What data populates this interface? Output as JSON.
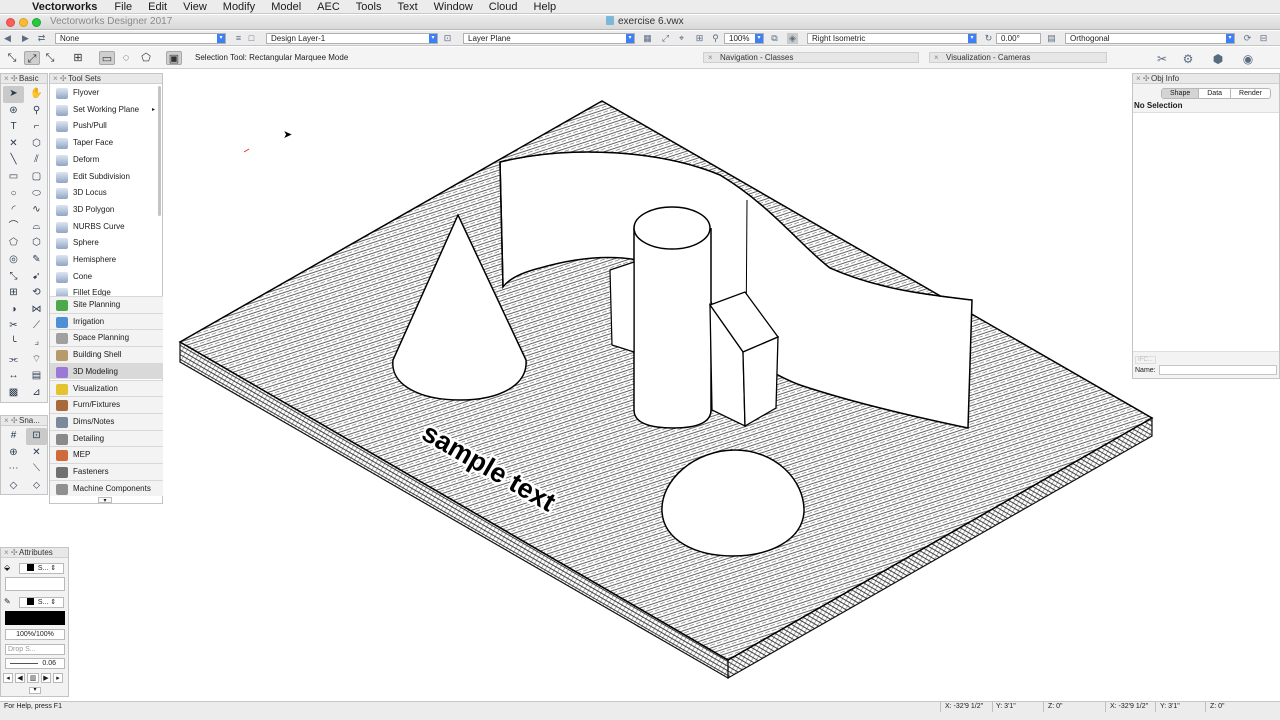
{
  "menubar": {
    "app_name": "Vectorworks",
    "items": [
      "File",
      "Edit",
      "View",
      "Modify",
      "Model",
      "AEC",
      "Tools",
      "Text",
      "Window",
      "Cloud",
      "Help"
    ]
  },
  "window": {
    "app_title": "Vectorworks Designer 2017",
    "doc_title": "exercise 6.vwx"
  },
  "viewbar": {
    "class_value": "None",
    "layer_value": "Design Layer-1",
    "plane_value": "Layer Plane",
    "zoom_value": "100%",
    "view_value": "Right Isometric",
    "angle_value": "0.00°",
    "projection_value": "Orthogonal"
  },
  "modebar": {
    "mode_text": "Selection Tool: Rectangular Marquee Mode"
  },
  "tabs": {
    "navigation": "Navigation - Classes",
    "visualization": "Visualization - Cameras"
  },
  "palettes": {
    "basic_title": "Basic",
    "toolsets_title": "Tool Sets",
    "snap_title": "Sna...",
    "attributes_title": "Attributes",
    "objinfo_title": "Obj Info"
  },
  "toolset_tools": [
    {
      "label": "Flyover",
      "icon": "flyover-icon"
    },
    {
      "label": "Set Working Plane",
      "icon": "working-plane-icon",
      "submenu": "▸"
    },
    {
      "label": "Push/Pull",
      "icon": "push-pull-icon"
    },
    {
      "label": "Taper Face",
      "icon": "taper-face-icon"
    },
    {
      "label": "Deform",
      "icon": "deform-icon"
    },
    {
      "label": "Edit Subdivision",
      "icon": "subdivision-icon"
    },
    {
      "label": "3D Locus",
      "icon": "locus-icon"
    },
    {
      "label": "3D Polygon",
      "icon": "polygon-icon"
    },
    {
      "label": "NURBS Curve",
      "icon": "nurbs-curve-icon"
    },
    {
      "label": "Sphere",
      "icon": "sphere-icon"
    },
    {
      "label": "Hemisphere",
      "icon": "hemisphere-icon"
    },
    {
      "label": "Cone",
      "icon": "cone-icon"
    },
    {
      "label": "Fillet Edge",
      "icon": "fillet-edge-icon"
    }
  ],
  "tool_sets": [
    {
      "label": "Site Planning",
      "icon": "site-planning-icon",
      "color": "#4caa4c"
    },
    {
      "label": "Irrigation",
      "icon": "irrigation-icon",
      "color": "#4f8fd6"
    },
    {
      "label": "Space Planning",
      "icon": "space-planning-icon",
      "color": "#a0a0a0"
    },
    {
      "label": "Building Shell",
      "icon": "building-shell-icon",
      "color": "#b89a6a"
    },
    {
      "label": "3D Modeling",
      "icon": "3d-modeling-icon",
      "color": "#9a7ad6",
      "selected": true
    },
    {
      "label": "Visualization",
      "icon": "visualization-icon",
      "color": "#e4c230"
    },
    {
      "label": "Furn/Fixtures",
      "icon": "furniture-icon",
      "color": "#a86a3a"
    },
    {
      "label": "Dims/Notes",
      "icon": "dims-notes-icon",
      "color": "#7a8a9a"
    },
    {
      "label": "Detailing",
      "icon": "detailing-icon",
      "color": "#8a8a8a"
    },
    {
      "label": "MEP",
      "icon": "mep-icon",
      "color": "#d06a3a"
    },
    {
      "label": "Fasteners",
      "icon": "fasteners-icon",
      "color": "#707070"
    },
    {
      "label": "Machine Components",
      "icon": "machine-components-icon",
      "color": "#909090"
    }
  ],
  "attributes": {
    "fill_style": "S...",
    "pen_style": "S...",
    "opacity": "100%/100%",
    "drop_shadow": "Drop S...",
    "line_weight": "0.06"
  },
  "objinfo": {
    "tabs": [
      "Shape",
      "Data",
      "Render"
    ],
    "selected_tab": "Shape",
    "no_selection": "No Selection",
    "ifc_label": "IFC...",
    "name_label": "Name:"
  },
  "canvas": {
    "text_object": "sample text"
  },
  "statusbar": {
    "help_text": "For Help, press F1",
    "x_abs": "X: -32'9 1/2\"",
    "y_abs": "Y: 3'1\"",
    "z_abs": "Z: 0\"",
    "x_rel": "X: -32'9 1/2\"",
    "y_rel": "Y: 3'1\"",
    "z_rel": "Z: 0\""
  },
  "colors": {
    "accent": "#3d7ff5",
    "close": "#fc5f57",
    "minimize": "#fdbc2e",
    "maximize": "#29c840"
  }
}
